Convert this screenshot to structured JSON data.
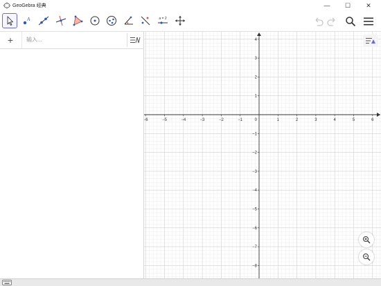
{
  "window": {
    "title": "GeoGebra 经典",
    "minimize_glyph": "—",
    "maximize_glyph": "☐",
    "close_glyph": "✕"
  },
  "toolbar": {
    "tools": [
      {
        "name": "move-tool",
        "icon": "arrow-cursor-icon",
        "selected": true
      },
      {
        "name": "point-tool",
        "icon": "point-a-icon",
        "selected": false
      },
      {
        "name": "line-tool",
        "icon": "line-icon",
        "selected": false
      },
      {
        "name": "perpendicular-line-tool",
        "icon": "perpendicular-icon",
        "selected": false
      },
      {
        "name": "polygon-tool",
        "icon": "polygon-icon",
        "selected": false
      },
      {
        "name": "circle-tool",
        "icon": "circle-center-icon",
        "selected": false
      },
      {
        "name": "ellipse-tool",
        "icon": "ellipse-icon",
        "selected": false
      },
      {
        "name": "angle-tool",
        "icon": "angle-icon",
        "selected": false
      },
      {
        "name": "reflect-tool",
        "icon": "reflect-icon",
        "selected": false
      },
      {
        "name": "slider-tool",
        "icon": "slider-icon",
        "selected": false
      },
      {
        "name": "move-graphics-view-tool",
        "icon": "pan-icon",
        "selected": false
      }
    ],
    "slider_label": "a = 2",
    "undo_icon": "undo-icon",
    "redo_icon": "redo-icon",
    "search_icon": "search-icon",
    "menu_icon": "hamburger-menu-icon"
  },
  "algebra": {
    "add_label": "+",
    "input_placeholder": "输入..."
  },
  "graphics": {
    "x_ticks": [
      "−6",
      "−5",
      "−4",
      "−3",
      "−2",
      "−1",
      "0",
      "1",
      "2",
      "3",
      "4",
      "5",
      "6"
    ],
    "y_ticks": [
      "4",
      "3",
      "2",
      "1",
      "−1",
      "−2",
      "−3",
      "−4",
      "−5",
      "−6",
      "−7",
      "−8"
    ],
    "x_range": [
      -6,
      6
    ],
    "y_range": [
      -8,
      4
    ],
    "grid": true,
    "axis_color": "#333333",
    "major_grid_color": "#cfcfcf",
    "minor_grid_color": "#ececec"
  },
  "accent_color": "#6c6cd5"
}
